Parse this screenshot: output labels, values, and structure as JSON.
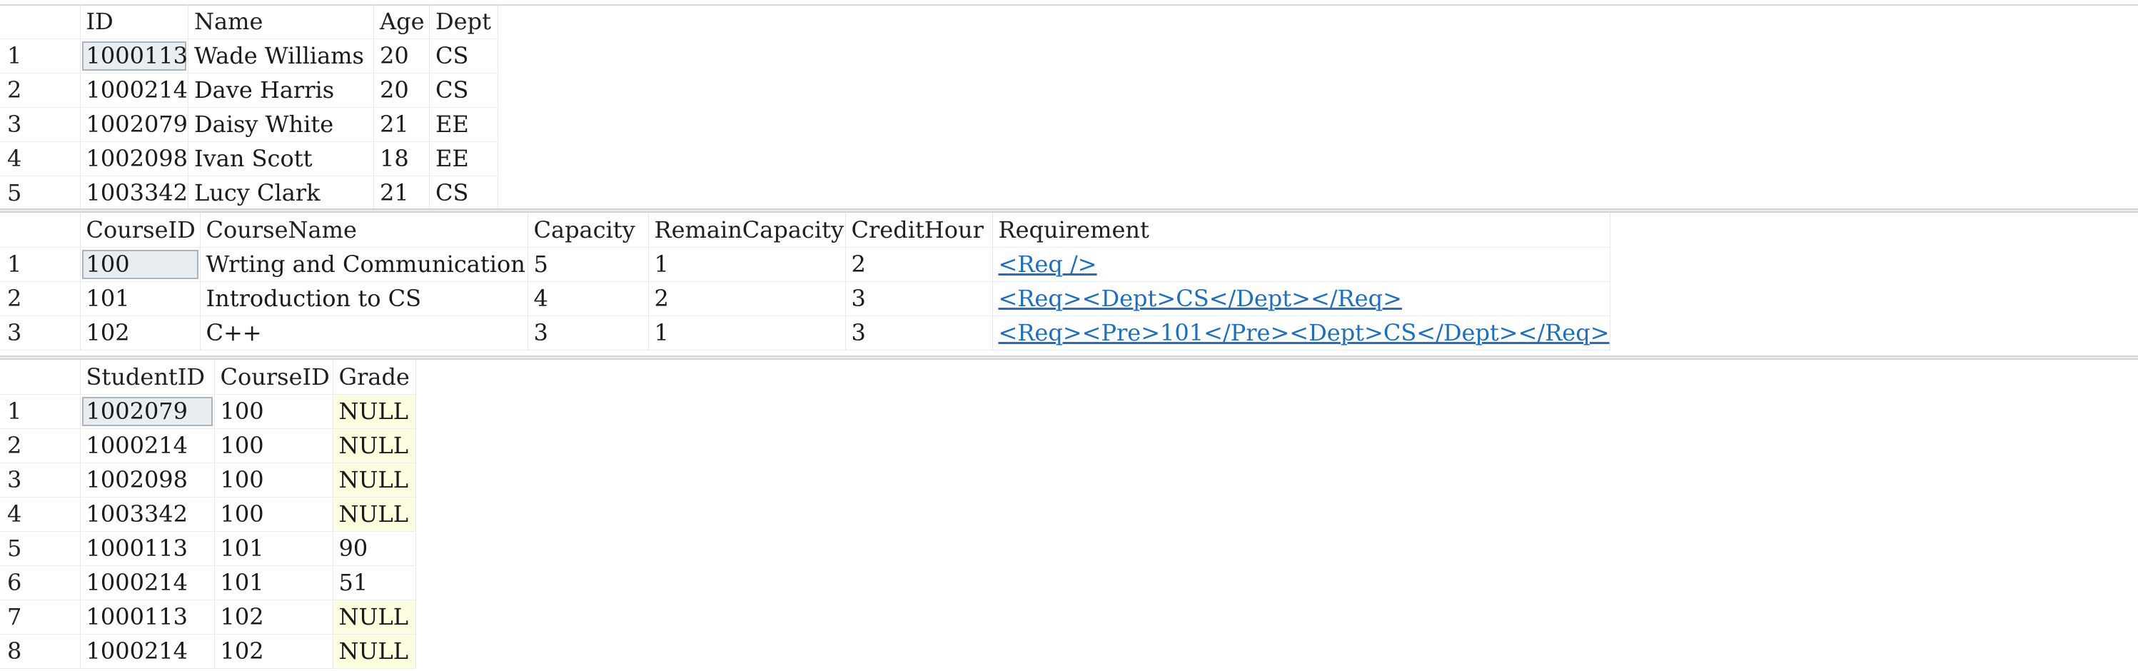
{
  "students": {
    "columns": [
      "ID",
      "Name",
      "Age",
      "Dept"
    ],
    "rows": [
      [
        "1",
        "1000113",
        "Wade Williams",
        "20",
        "CS"
      ],
      [
        "2",
        "1000214",
        "Dave Harris",
        "20",
        "CS"
      ],
      [
        "3",
        "1002079",
        "Daisy White",
        "21",
        "EE"
      ],
      [
        "4",
        "1002098",
        "Ivan Scott",
        "18",
        "EE"
      ],
      [
        "5",
        "1003342",
        "Lucy Clark",
        "21",
        "CS"
      ]
    ]
  },
  "courses": {
    "columns": [
      "CourseID",
      "CourseName",
      "Capacity",
      "RemainCapacity",
      "CreditHour",
      "Requirement"
    ],
    "rows": [
      [
        "1",
        "100",
        "Wrting and Communication",
        "5",
        "1",
        "2",
        "<Req />"
      ],
      [
        "2",
        "101",
        "Introduction to CS",
        "4",
        "2",
        "3",
        "<Req><Dept>CS</Dept></Req>"
      ],
      [
        "3",
        "102",
        "C++",
        "3",
        "1",
        "3",
        "<Req><Pre>101</Pre><Dept>CS</Dept></Req>"
      ]
    ]
  },
  "enrollments": {
    "columns": [
      "StudentID",
      "CourseID",
      "Grade"
    ],
    "rows": [
      [
        "1",
        "1002079",
        "100",
        "NULL"
      ],
      [
        "2",
        "1000214",
        "100",
        "NULL"
      ],
      [
        "3",
        "1002098",
        "100",
        "NULL"
      ],
      [
        "4",
        "1003342",
        "100",
        "NULL"
      ],
      [
        "5",
        "1000113",
        "101",
        "90"
      ],
      [
        "6",
        "1000214",
        "101",
        "51"
      ],
      [
        "7",
        "1000113",
        "102",
        "NULL"
      ],
      [
        "8",
        "1000214",
        "102",
        "NULL"
      ]
    ]
  },
  "colors": {
    "null_highlight": "#fdfde0",
    "xml_link": "#1a6fc4",
    "selected_cell": "#d6dee6"
  }
}
